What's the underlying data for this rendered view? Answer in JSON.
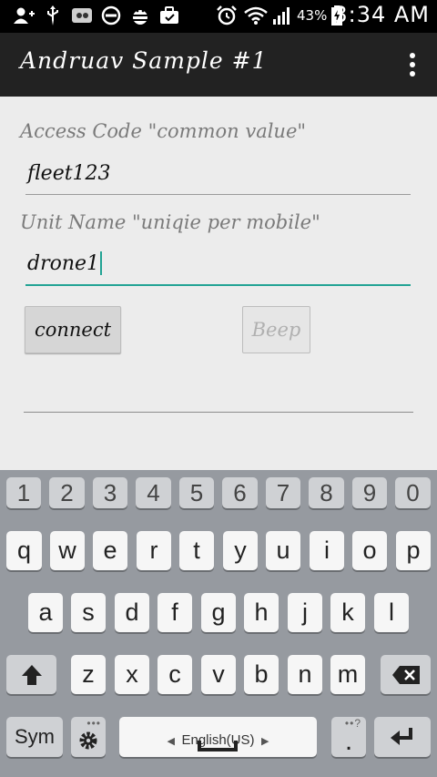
{
  "status_bar": {
    "battery": "43%",
    "time": "3:34 AM",
    "icons": [
      "add-contact-icon",
      "usb-icon",
      "voicemail-icon",
      "do-not-disturb-icon",
      "android-debug-icon",
      "briefcase-icon",
      "alarm-icon",
      "wifi-icon",
      "signal-icon",
      "battery-charging-icon"
    ]
  },
  "app": {
    "title": "Andruav Sample #1",
    "menu_icon": "overflow-menu-icon"
  },
  "form": {
    "access_code_label": "Access Code \"common value\"",
    "access_code_value": "fleet123",
    "unit_name_label": "Unit Name \"uniqie per mobile\"",
    "unit_name_value": "drone1",
    "connect_label": "connect",
    "beep_label": "Beep",
    "output_text": ""
  },
  "keyboard": {
    "numbers": [
      "1",
      "2",
      "3",
      "4",
      "5",
      "6",
      "7",
      "8",
      "9",
      "0"
    ],
    "row1": [
      "q",
      "w",
      "e",
      "r",
      "t",
      "y",
      "u",
      "i",
      "o",
      "p"
    ],
    "row2": [
      "a",
      "s",
      "d",
      "f",
      "g",
      "h",
      "j",
      "k",
      "l"
    ],
    "row3": [
      "z",
      "x",
      "c",
      "v",
      "b",
      "n",
      "m"
    ],
    "sym_label": "Sym",
    "language_label": "English(US)",
    "period_label": ".",
    "period_hint": "••?",
    "settings_hint": "•••"
  }
}
